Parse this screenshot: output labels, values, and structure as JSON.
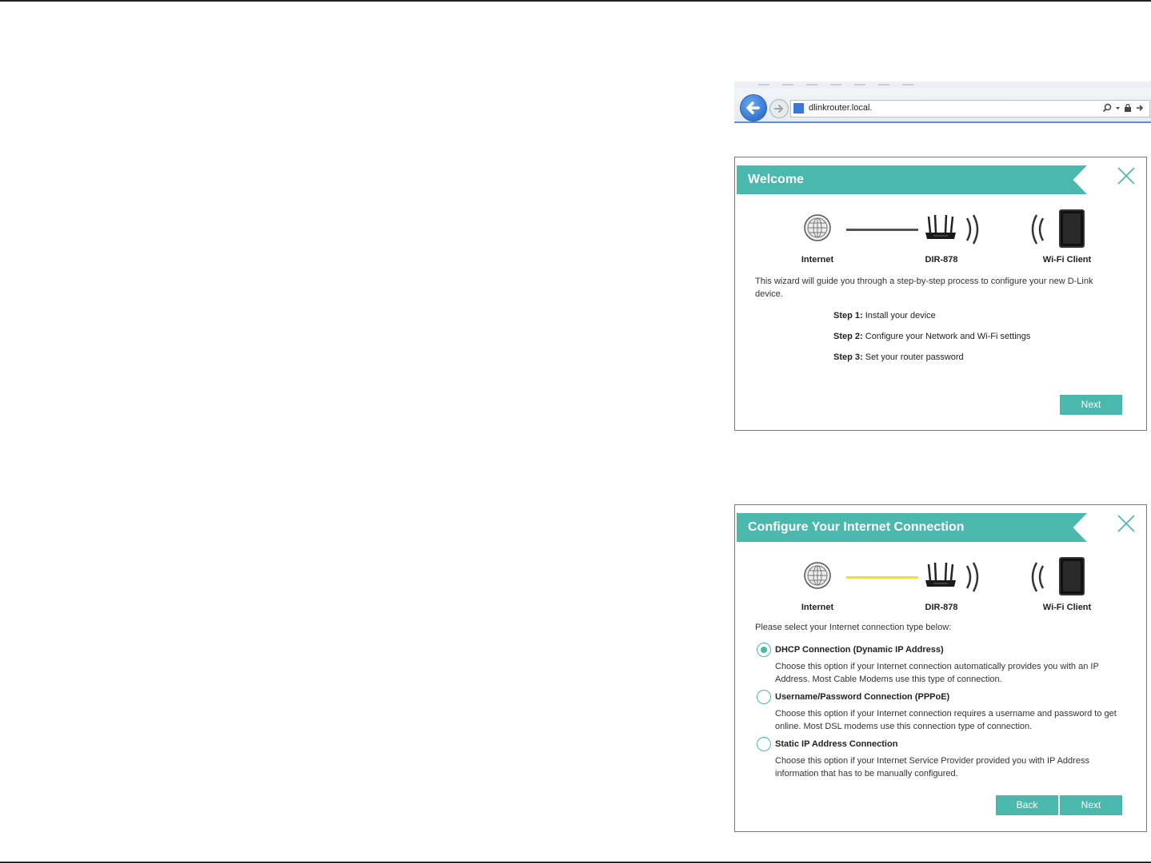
{
  "browser": {
    "url": "dlinkrouter.local."
  },
  "diagram": {
    "internet_label": "Internet",
    "router_label": "DIR-878",
    "client_label": "Wi-Fi Client"
  },
  "welcome": {
    "title": "Welcome",
    "intro": "This wizard will guide you through a step-by-step process to configure your new D-Link device.",
    "steps": [
      {
        "label": "Step 1:",
        "text": "Install your device"
      },
      {
        "label": "Step 2:",
        "text": "Configure your Network and Wi-Fi settings"
      },
      {
        "label": "Step 3:",
        "text": "Set your router password"
      }
    ],
    "next_label": "Next",
    "link_color": "#555555"
  },
  "connect": {
    "title": "Configure Your Internet Connection",
    "prompt": "Please select your Internet connection type below:",
    "options": [
      {
        "title": "DHCP Connection (Dynamic IP Address)",
        "desc": "Choose this option if your Internet connection automatically provides you with an IP Address. Most Cable Modems use this type of connection.",
        "selected": true
      },
      {
        "title": "Username/Password Connection (PPPoE)",
        "desc": "Choose this option if your Internet connection requires a username and password to get online. Most DSL modems use this connection type of connection.",
        "selected": false
      },
      {
        "title": "Static IP Address Connection",
        "desc": "Choose this option if your Internet Service Provider provided you with IP Address information that has to be manually configured.",
        "selected": false
      }
    ],
    "back_label": "Back",
    "next_label": "Next",
    "link_color": "#f2e600"
  },
  "colors": {
    "accent": "#4ab8ad"
  }
}
